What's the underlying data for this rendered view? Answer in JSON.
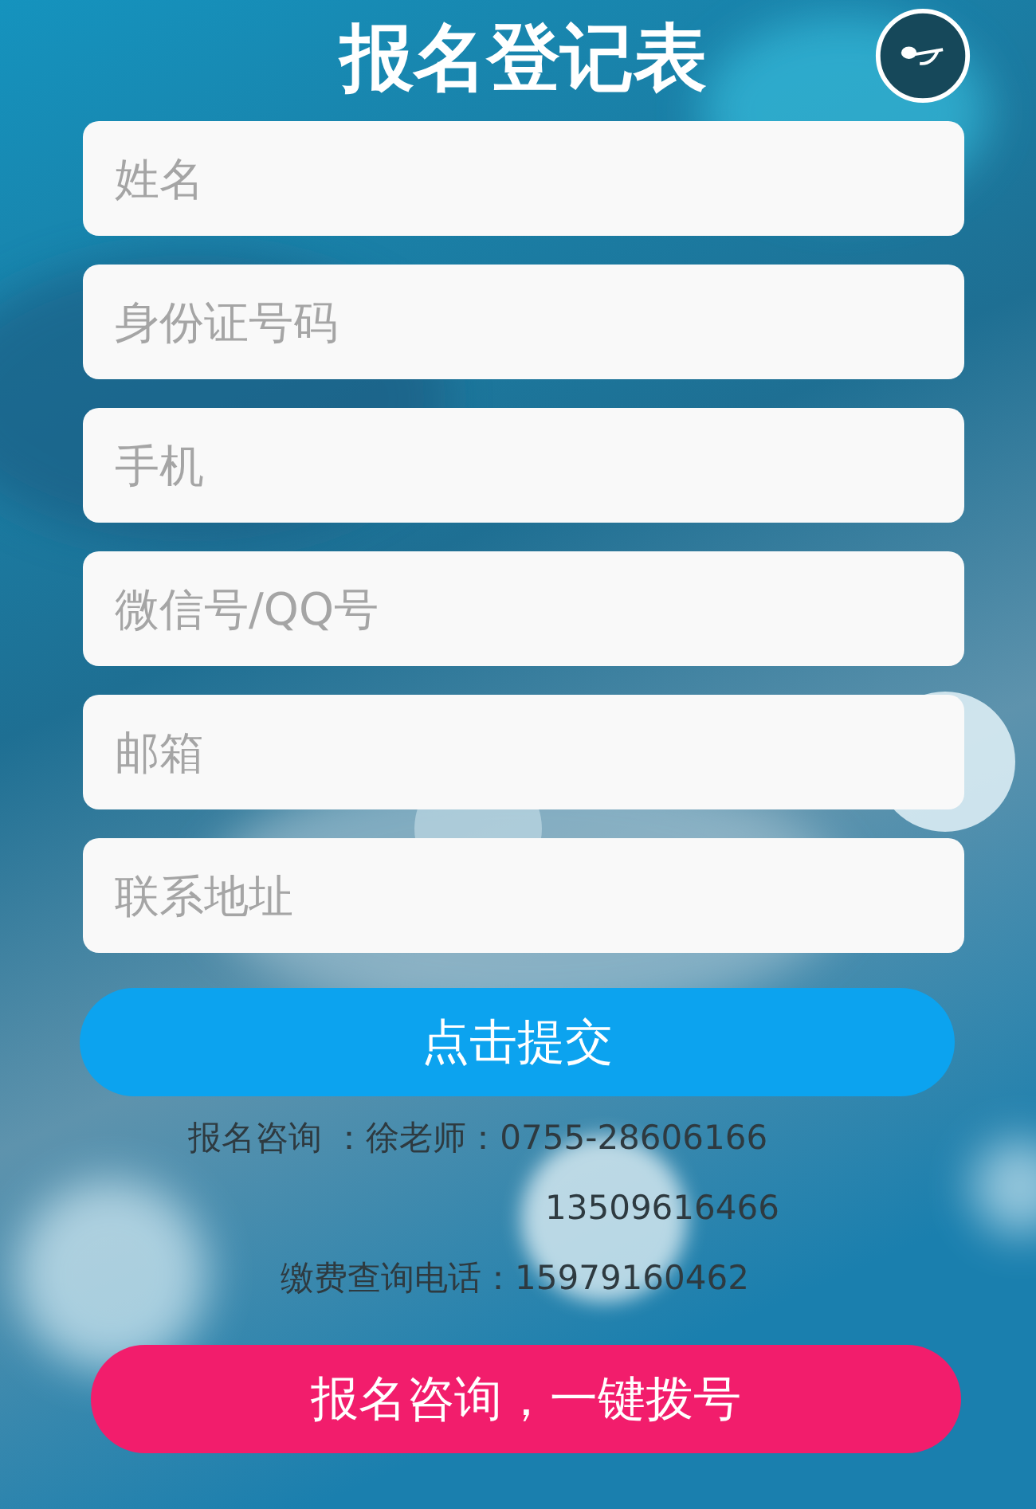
{
  "title": "报名登记表",
  "fields": [
    {
      "placeholder": "姓名"
    },
    {
      "placeholder": "身份证号码"
    },
    {
      "placeholder": "手机"
    },
    {
      "placeholder": "微信号/QQ号"
    },
    {
      "placeholder": "邮箱"
    },
    {
      "placeholder": "联系地址"
    }
  ],
  "submit_button": "点击提交",
  "contact_lines": [
    {
      "kind": "first",
      "text": "报名咨询 ：徐老师：0755-28606166"
    },
    {
      "kind": "second",
      "text": "13509616466"
    },
    {
      "kind": "third",
      "text": "缴费查询电话：15979160462"
    }
  ],
  "call_button": "报名咨询，一键拨号"
}
